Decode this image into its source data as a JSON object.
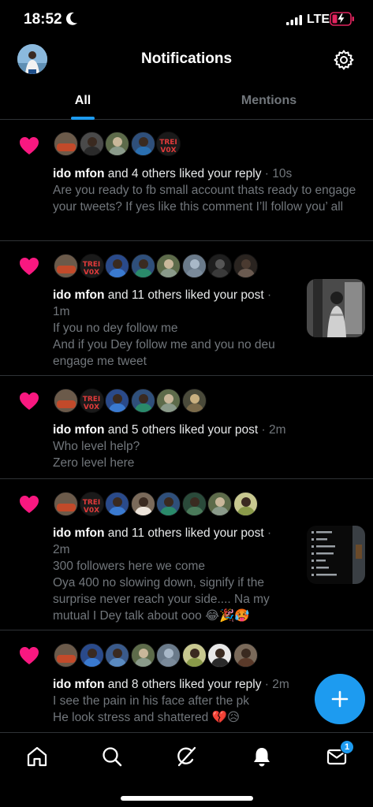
{
  "status_bar": {
    "time": "18:52",
    "network": "LTE",
    "icons": [
      "moon-icon",
      "signal-icon",
      "battery-charging-icon"
    ]
  },
  "header": {
    "title": "Notifications",
    "avatar_icon": "user-avatar",
    "settings_icon": "gear-icon"
  },
  "tabs": [
    {
      "label": "All",
      "selected": true
    },
    {
      "label": "Mentions",
      "selected": false
    }
  ],
  "colors": {
    "accent": "#1d9bf0",
    "like": "#f91880",
    "muted_text": "#71767b",
    "background": "#000000"
  },
  "notifications": [
    {
      "name": "ido mfon",
      "action": "and 4 others liked your reply",
      "time": "10s",
      "text": "Are you ready to fb small account thats ready to engage your tweets? If yes like this comment I’ll follow you’ all",
      "avatar_count": 5
    },
    {
      "name": "ido mfon",
      "action": "and 11 others liked your post",
      "time": "1m",
      "text": "If you no dey follow me\nAnd if you Dey follow me and you no deu engage me tweet",
      "avatar_count": 8,
      "has_thumbnail": true
    },
    {
      "name": "ido mfon",
      "action": "and 5 others liked your post",
      "time": "2m",
      "text": "Who level help?\nZero level here",
      "avatar_count": 6
    },
    {
      "name": "ido mfon",
      "action": "and 11 others liked your post",
      "time": "2m",
      "text": "300 followers here we come\nOya 400 no slowing down, signify if the surprise never reach your side.... Na my mutual I Dey talk about ooo 😂🎉🥵",
      "avatar_count": 8,
      "has_thumbnail": true
    },
    {
      "name": "ido mfon",
      "action": "and 8 others liked your reply",
      "time": "2m",
      "text": "I see the pain in his face after the pk\nHe look stress and shattered 💔😥",
      "avatar_count": 8
    }
  ],
  "avatar_labels": {
    "treivox": "TREI\nV0X"
  },
  "fab": {
    "icon": "plus-icon"
  },
  "bottom_nav": {
    "items": [
      "home-icon",
      "search-icon",
      "grok-icon",
      "bell-icon",
      "mail-icon"
    ],
    "mail_badge": "1"
  }
}
